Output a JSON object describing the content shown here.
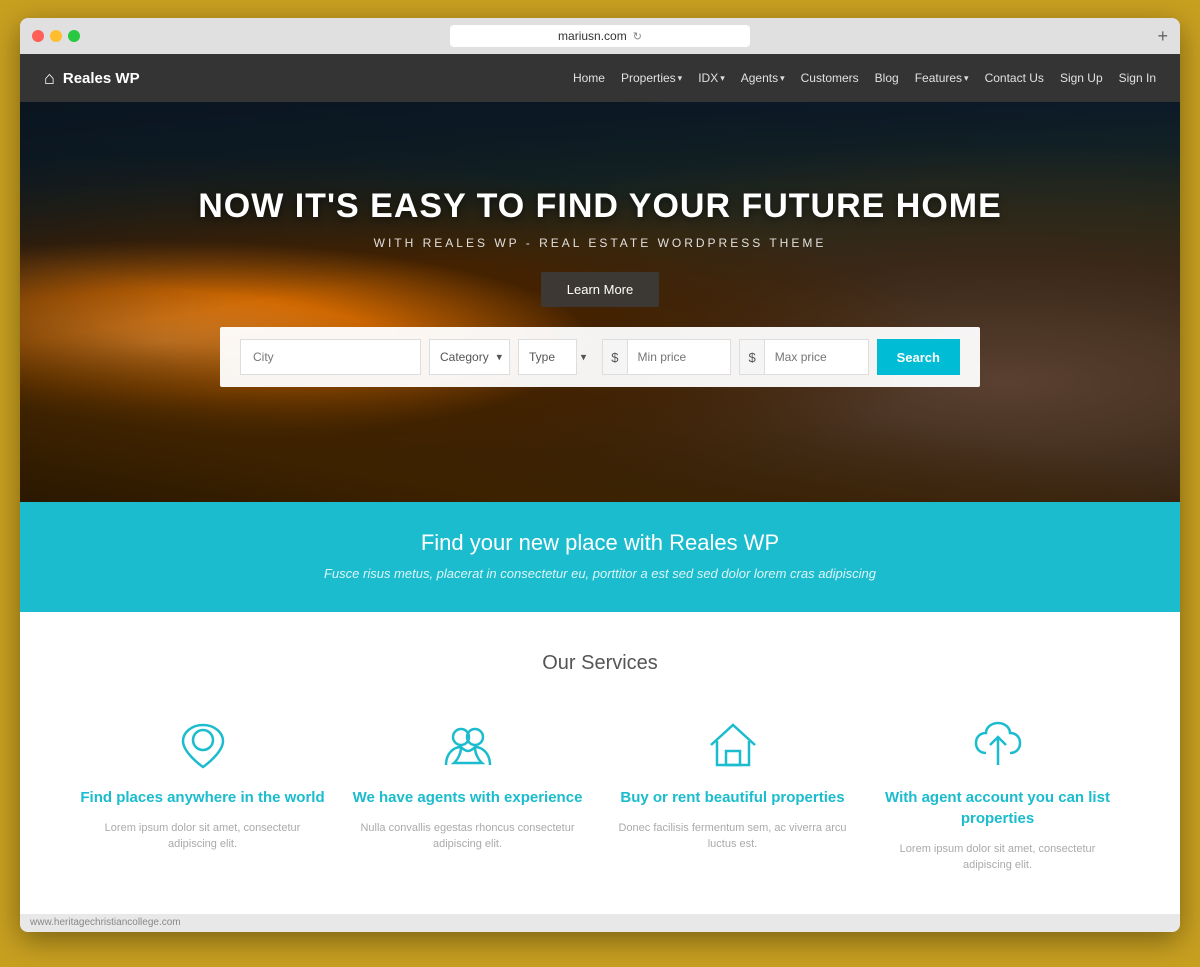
{
  "browser": {
    "url": "mariusn.com",
    "refresh_label": "↻",
    "add_tab_label": "+"
  },
  "nav": {
    "brand": "Reales WP",
    "links": [
      {
        "label": "Home",
        "has_dropdown": false
      },
      {
        "label": "Properties",
        "has_dropdown": true
      },
      {
        "label": "IDX",
        "has_dropdown": true
      },
      {
        "label": "Agents",
        "has_dropdown": true
      },
      {
        "label": "Customers",
        "has_dropdown": false
      },
      {
        "label": "Blog",
        "has_dropdown": false
      },
      {
        "label": "Features",
        "has_dropdown": true
      },
      {
        "label": "Contact Us",
        "has_dropdown": false
      },
      {
        "label": "Sign Up",
        "has_dropdown": false
      },
      {
        "label": "Sign In",
        "has_dropdown": false
      }
    ]
  },
  "hero": {
    "title": "NOW IT'S EASY TO FIND YOUR FUTURE HOME",
    "subtitle": "WITH REALES WP - REAL ESTATE WORDPRESS THEME",
    "cta_label": "Learn More"
  },
  "search": {
    "city_placeholder": "City",
    "category_label": "Category",
    "type_label": "Type",
    "min_price_placeholder": "Min price",
    "max_price_placeholder": "Max price",
    "search_label": "Search",
    "currency_symbol": "$"
  },
  "teal_banner": {
    "heading": "Find your new place with Reales WP",
    "subtext": "Fusce risus metus, placerat in consectetur eu, porttitor a est sed sed dolor lorem cras adipiscing"
  },
  "services": {
    "section_title": "Our Services",
    "items": [
      {
        "icon": "location",
        "name": "Find places anywhere in the world",
        "desc": "Lorem ipsum dolor sit amet, consectetur adipiscing elit."
      },
      {
        "icon": "agent",
        "name": "We have agents with experience",
        "desc": "Nulla convallis egestas rhoncus consectetur adipiscing elit."
      },
      {
        "icon": "home",
        "name": "Buy or rent beautiful properties",
        "desc": "Donec facilisis fermentum sem, ac viverra arcu luctus est."
      },
      {
        "icon": "cloud",
        "name": "With agent account you can list properties",
        "desc": "Lorem ipsum dolor sit amet, consectetur adipiscing elit."
      }
    ]
  },
  "status_bar": {
    "url": "www.heritagechristiancollege.com"
  }
}
